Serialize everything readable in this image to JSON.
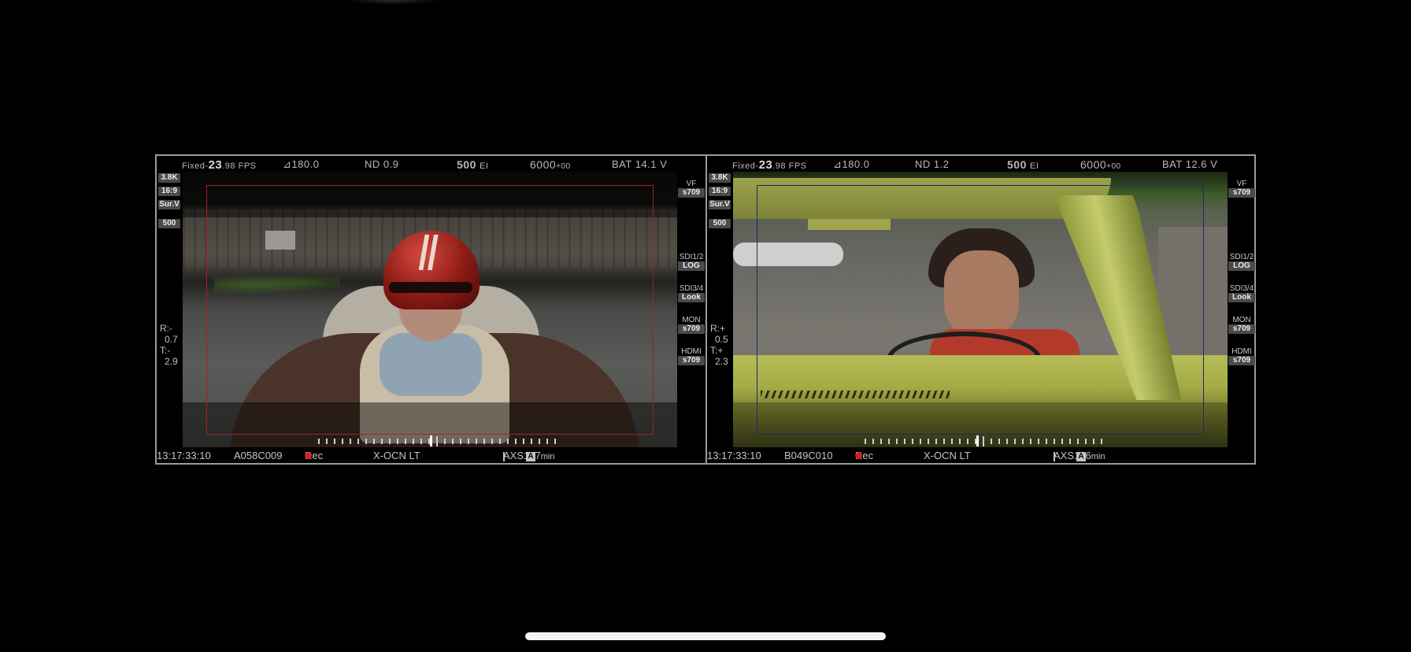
{
  "monitors": [
    {
      "top": {
        "fps_prefix": "Fixed-",
        "fps_value": "23",
        "fps_suffix": ".98 FPS",
        "shutter": "⊿180.0",
        "nd": "ND 0.9",
        "ei": "500",
        "ei_unit": "EI",
        "wb": "6000",
        "wb_tint": "+00",
        "battery": "BAT 14.1 V"
      },
      "left_tags": [
        "3.8K",
        "16:9",
        "Sur.V",
        "500"
      ],
      "right_tags": [
        {
          "label": "VF",
          "value": "s709"
        },
        {
          "label": "SDI1/2",
          "value": "LOG"
        },
        {
          "label": "SDI3/4",
          "value": "Look"
        },
        {
          "label": "MON",
          "value": "s709"
        },
        {
          "label": "HDMI",
          "value": "s709"
        }
      ],
      "rt": {
        "r_label": "R:-",
        "r_value": "0.7",
        "t_label": "T:-",
        "t_value": "2.9"
      },
      "bottom": {
        "timecode": "13:17:33:10",
        "clip": "A058C009",
        "rec": "Rec",
        "codec": "X-OCN LT",
        "media": "AXS",
        "media_slot": "A",
        "minutes": "147",
        "min_unit": "min"
      }
    },
    {
      "top": {
        "fps_prefix": "Fixed-",
        "fps_value": "23",
        "fps_suffix": ".98 FPS",
        "shutter": "⊿180.0",
        "nd": "ND 1.2",
        "ei": "500",
        "ei_unit": "EI",
        "wb": "6000",
        "wb_tint": "+00",
        "battery": "BAT 12.6 V"
      },
      "left_tags": [
        "3.8K",
        "16:9",
        "Sur.V",
        "500"
      ],
      "right_tags": [
        {
          "label": "VF",
          "value": "s709"
        },
        {
          "label": "SDI1/2",
          "value": "LOG"
        },
        {
          "label": "SDI3/4",
          "value": "Look"
        },
        {
          "label": "MON",
          "value": "s709"
        },
        {
          "label": "HDMI",
          "value": "s709"
        }
      ],
      "rt": {
        "r_label": "R:+",
        "r_value": "0.5",
        "t_label": "T:+",
        "t_value": "2.3"
      },
      "bottom": {
        "timecode": "13:17:33:10",
        "clip": "B049C010",
        "rec": "Rec",
        "codec": "X-OCN LT",
        "media": "AXS",
        "media_slot": "A",
        "minutes": "146",
        "min_unit": "min"
      }
    }
  ],
  "colors": {
    "frameline_left": "#a52020",
    "frameline_right": "#1c2a66",
    "rec_dot": "#d62020"
  }
}
